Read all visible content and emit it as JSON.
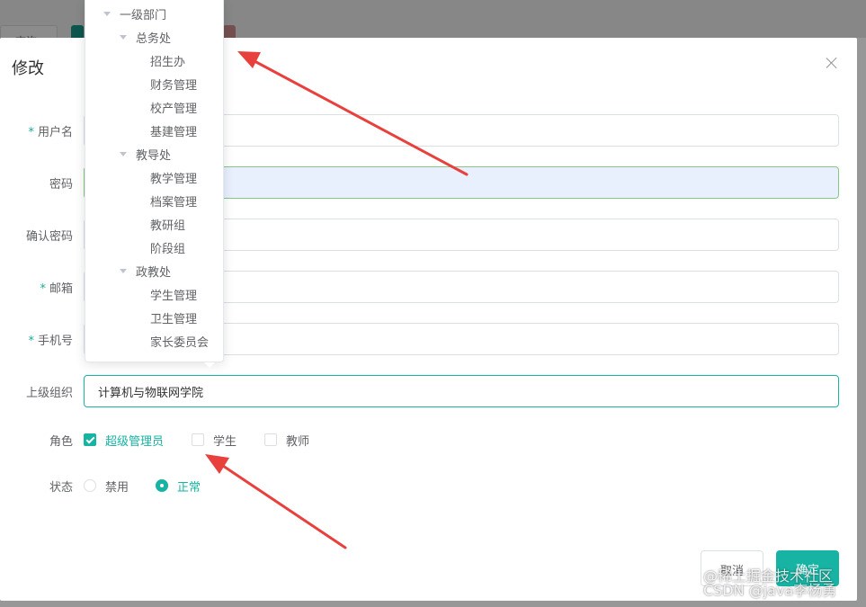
{
  "background": {
    "button_label": "查询"
  },
  "dialog": {
    "title": "修改",
    "fields": {
      "username": {
        "label": "用户名",
        "required": true,
        "value": ""
      },
      "password": {
        "label": "密码",
        "required": false,
        "value": ""
      },
      "confirm_password": {
        "label": "确认密码",
        "required": false,
        "value": ""
      },
      "email": {
        "label": "邮箱",
        "required": true,
        "value": ""
      },
      "phone": {
        "label": "手机号",
        "required": true,
        "value": ""
      },
      "parent_org": {
        "label": "上级组织",
        "value": "计算机与物联网学院"
      }
    },
    "required_mark": "*",
    "roles": {
      "label": "角色",
      "options": [
        {
          "label": "超级管理员",
          "checked": true
        },
        {
          "label": "学生",
          "checked": false
        },
        {
          "label": "教师",
          "checked": false
        }
      ]
    },
    "status": {
      "label": "状态",
      "options": [
        {
          "label": "禁用",
          "selected": false
        },
        {
          "label": "正常",
          "selected": true
        }
      ]
    },
    "buttons": {
      "cancel": "取消",
      "confirm": "确定"
    }
  },
  "org_tree": {
    "nodes": [
      {
        "label": "一级部门",
        "level": 0,
        "expanded": true
      },
      {
        "label": "总务处",
        "level": 1,
        "expanded": true
      },
      {
        "label": "招生办",
        "level": 2
      },
      {
        "label": "财务管理",
        "level": 2
      },
      {
        "label": "校产管理",
        "level": 2
      },
      {
        "label": "基建管理",
        "level": 2
      },
      {
        "label": "教导处",
        "level": 1,
        "expanded": true
      },
      {
        "label": "教学管理",
        "level": 2
      },
      {
        "label": "档案管理",
        "level": 2
      },
      {
        "label": "教研组",
        "level": 2
      },
      {
        "label": "阶段组",
        "level": 2
      },
      {
        "label": "政教处",
        "level": 1,
        "expanded": true
      },
      {
        "label": "学生管理",
        "level": 2
      },
      {
        "label": "卫生管理",
        "level": 2
      },
      {
        "label": "家长委员会",
        "level": 2
      }
    ]
  },
  "colors": {
    "primary": "#17b3a3",
    "arrow": "#e8403c",
    "autofill_bg": "#e8f0fe"
  },
  "watermark": {
    "line1": "@稀土掘金技术社区",
    "line2": "CSDN @java李杨勇"
  }
}
